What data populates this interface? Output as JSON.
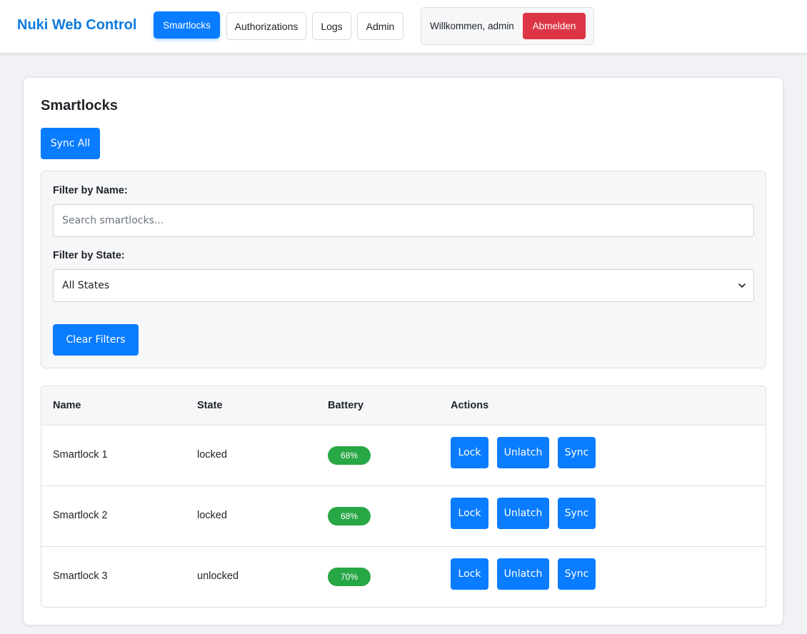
{
  "header": {
    "brand": "Nuki Web Control",
    "nav": [
      {
        "label": "Smartlocks",
        "active": true
      },
      {
        "label": "Authorizations",
        "active": false
      },
      {
        "label": "Logs",
        "active": false
      },
      {
        "label": "Admin",
        "active": false
      }
    ],
    "welcome": "Willkommen, admin",
    "logout_label": "Abmelden"
  },
  "main": {
    "title": "Smartlocks",
    "sync_all_label": "Sync All",
    "filters": {
      "name_label": "Filter by Name:",
      "name_placeholder": "Search smartlocks...",
      "state_label": "Filter by State:",
      "state_selected": "All States",
      "clear_label": "Clear Filters"
    },
    "table": {
      "columns": [
        "Name",
        "State",
        "Battery",
        "Actions"
      ],
      "rows": [
        {
          "name": "Smartlock 1",
          "state": "locked",
          "battery": "68%"
        },
        {
          "name": "Smartlock 2",
          "state": "locked",
          "battery": "68%"
        },
        {
          "name": "Smartlock 3",
          "state": "unlocked",
          "battery": "70%"
        }
      ],
      "actions": {
        "lock": "Lock",
        "unlatch": "Unlatch",
        "sync": "Sync"
      }
    }
  },
  "colors": {
    "primary": "#0a7cff",
    "brand": "#0d7be0",
    "danger": "#dc3545",
    "success": "#28a745",
    "background": "#f0f2f5"
  },
  "icons": {
    "select_chevron": "chevron-down-icon"
  }
}
